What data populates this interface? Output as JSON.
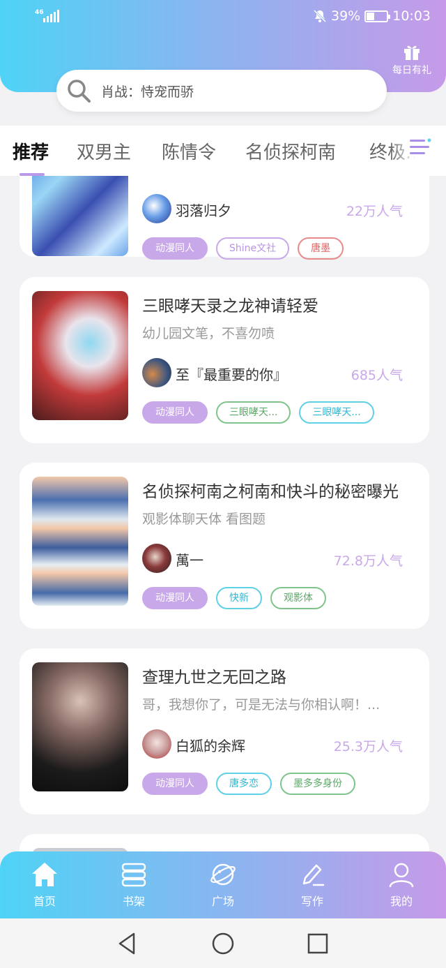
{
  "status_bar": {
    "network": "46",
    "battery_percent": "39%",
    "battery_level": 0.39,
    "time": "10:03"
  },
  "gift": {
    "label": "每日有礼"
  },
  "search": {
    "placeholder": "肖战：恃宠而骄"
  },
  "tabs": [
    {
      "label": "推荐",
      "active": true
    },
    {
      "label": "双男主"
    },
    {
      "label": "陈情令"
    },
    {
      "label": "名侦探柯南"
    },
    {
      "label": "终极..."
    }
  ],
  "cards": [
    {
      "author": "羽落归夕",
      "popularity": "22万人气",
      "tags": [
        "动漫同人",
        "Shine文社",
        "唐墨"
      ]
    },
    {
      "title": "三眼哮天录之龙神请轻爱",
      "desc": "幼儿园文笔，不喜勿喷",
      "author": "至『最重要的你』",
      "popularity": "685人气",
      "tags": [
        "动漫同人",
        "三眼哮天...",
        "三眼哮天..."
      ]
    },
    {
      "title": "名侦探柯南之柯南和快斗的秘密曝光",
      "desc": "观影体聊天体 看图题",
      "author": "萬一",
      "popularity": "72.8万人气",
      "tags": [
        "动漫同人",
        "快新",
        "观影体"
      ]
    },
    {
      "title": "查理九世之无回之路",
      "desc": "哥，我想你了，可是无法与你相认啊！...",
      "author": "白狐的余辉",
      "popularity": "25.3万人气",
      "tags": [
        "动漫同人",
        "唐多恋",
        "墨多多身份"
      ]
    }
  ],
  "bottom_nav": [
    {
      "label": "首页",
      "icon": "home-icon",
      "active": true
    },
    {
      "label": "书架",
      "icon": "bookshelf-icon"
    },
    {
      "label": "广场",
      "icon": "planet-icon"
    },
    {
      "label": "写作",
      "icon": "pen-icon"
    },
    {
      "label": "我的",
      "icon": "user-icon"
    }
  ],
  "system_nav": [
    "back-icon",
    "home-circle-icon",
    "recents-icon"
  ],
  "colors": {
    "accent": "#c9a8ea",
    "gradient_start": "#4fd3f6",
    "gradient_end": "#c69ae8"
  }
}
